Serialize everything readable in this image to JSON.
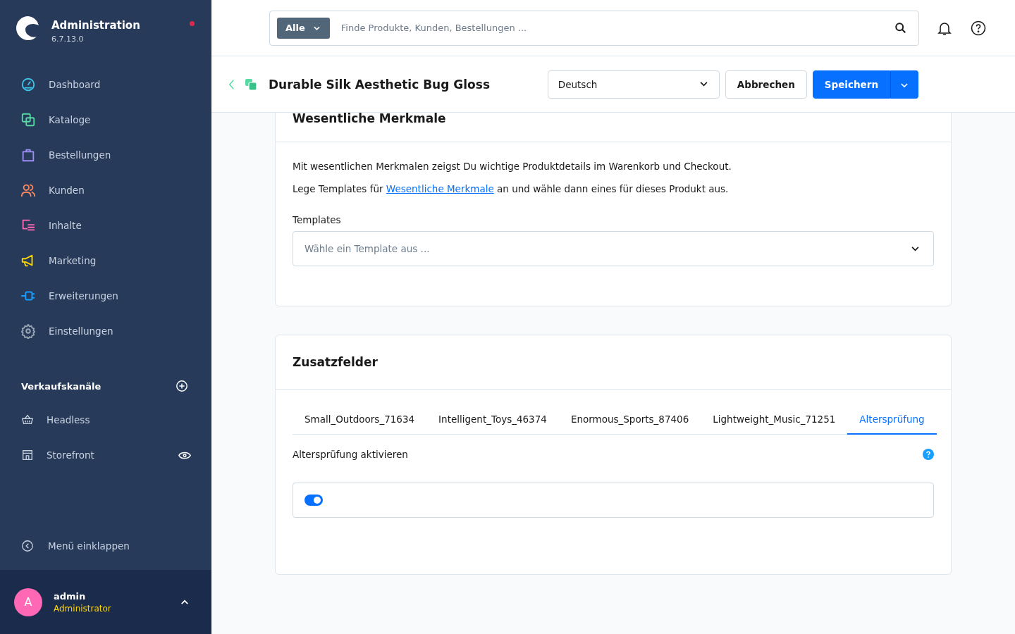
{
  "sidebar": {
    "title": "Administration",
    "version": "6.7.13.0",
    "notification": true,
    "items": [
      {
        "label": "Dashboard",
        "color": "#3fc5e8"
      },
      {
        "label": "Kataloge",
        "color": "#57d9a3"
      },
      {
        "label": "Bestellungen",
        "color": "#9e8ef5"
      },
      {
        "label": "Kunden",
        "color": "#f88962"
      },
      {
        "label": "Inhalte",
        "color": "#ff68b4"
      },
      {
        "label": "Marketing",
        "color": "#ffd700"
      },
      {
        "label": "Erweiterungen",
        "color": "#189eff"
      },
      {
        "label": "Einstellungen",
        "color": "#9aa8b5"
      }
    ],
    "sales_channels": {
      "title": "Verkaufskanäle",
      "items": [
        {
          "label": "Headless",
          "preview": false
        },
        {
          "label": "Storefront",
          "preview": true
        }
      ]
    },
    "collapse": "Menü einklappen",
    "user": {
      "initial": "A",
      "name": "admin",
      "role": "Administrator"
    }
  },
  "search": {
    "scope": "Alle",
    "placeholder": "Finde Produkte, Kunden, Bestellungen ..."
  },
  "page_header": {
    "title": "Durable Silk Aesthetic Bug Gloss",
    "language": "Deutsch",
    "cancel": "Abbrechen",
    "save": "Speichern"
  },
  "essential_card": {
    "title": "Wesentliche Merkmale",
    "text": "Mit wesentlichen Merkmalen zeigst Du wichtige Produktdetails im Warenkorb und Checkout.",
    "text2_before": "Lege Templates für",
    "link": "Wesentliche Merkmale",
    "text2_after": "an und wähle dann eines für dieses Produkt aus.",
    "field_label": "Templates",
    "placeholder": "Wähle ein Template aus ..."
  },
  "custom_fields": {
    "title": "Zusatzfelder",
    "tabs": [
      {
        "label": "Small_Outdoors_71634",
        "selected": false
      },
      {
        "label": "Intelligent_Toys_46374",
        "selected": false
      },
      {
        "label": "Enormous_Sports_87406",
        "selected": false
      },
      {
        "label": "Lightweight_Music_71251",
        "selected": false
      },
      {
        "label": "Altersprüfung",
        "selected": true
      }
    ],
    "field_label": "Altersprüfung aktivieren",
    "checked": true
  }
}
